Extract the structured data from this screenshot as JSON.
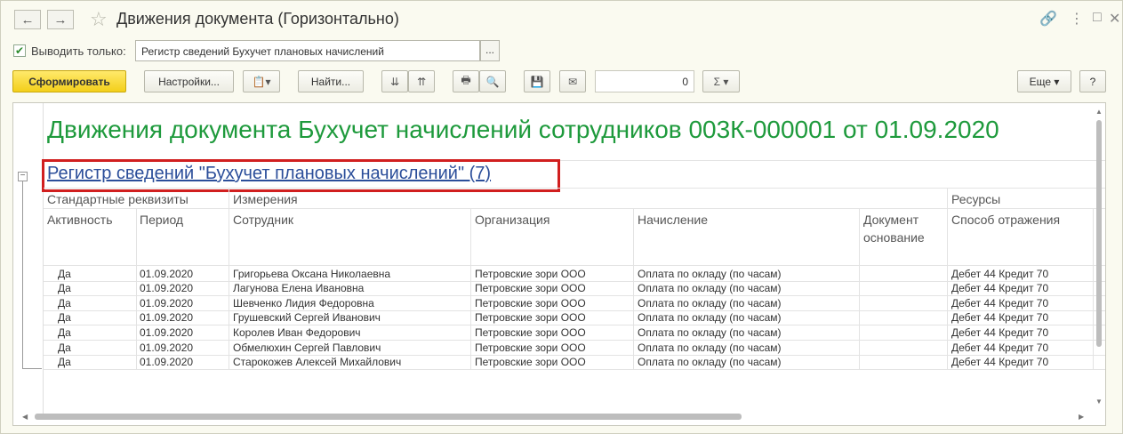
{
  "window": {
    "title": "Движения документа (Горизонтально)",
    "nav_back": "←",
    "nav_forward": "→",
    "favorite_icon": "☆",
    "link_icon": "🔗",
    "menu_icon": "⋮",
    "maximize_icon": "□",
    "close_icon": "✕"
  },
  "filter": {
    "checked": "✔",
    "label": "Выводить только:",
    "value": "Регистр сведений Бухучет плановых начислений",
    "select_button": "..."
  },
  "toolbar": {
    "generate_label": "Сформировать",
    "settings_label": "Настройки...",
    "variants_icon": "📋▾",
    "find_label": "Найти...",
    "expand_icon": "⇊",
    "collapse_icon": "⇈",
    "print_icon": "🖶",
    "preview_icon": "🔍",
    "save_icon": "💾",
    "mail_icon": "✉",
    "counter_value": "0",
    "sum_label": "Σ ▾",
    "more_label": "Еще ▾",
    "help_label": "?"
  },
  "report": {
    "title": "Движения документа Бухучет начислений сотрудников 003К-000001 от 01.09.2020",
    "register_link": "Регистр сведений \"Бухучет плановых начислений\" (7)",
    "group_toggle": "−",
    "header_groups": {
      "standard": "Стандартные реквизиты",
      "dimensions": "Измерения",
      "resources": "Ресурсы"
    },
    "columns": {
      "active": "Активность",
      "period": "Период",
      "employee": "Сотрудник",
      "organization": "Организация",
      "accrual": "Начисление",
      "document_line1": "Документ",
      "document_line2": "основание",
      "method": "Способ отражения"
    },
    "rows": [
      {
        "active": "Да",
        "period": "01.09.2020",
        "employee": "Григорьева Оксана Николаевна",
        "organization": "Петровские зори ООО",
        "accrual": "Оплата по окладу (по часам)",
        "method": "Дебет 44 Кредит 70"
      },
      {
        "active": "Да",
        "period": "01.09.2020",
        "employee": "Лагунова Елена Ивановна",
        "organization": "Петровские зори ООО",
        "accrual": "Оплата по окладу (по часам)",
        "method": "Дебет 44 Кредит 70"
      },
      {
        "active": "Да",
        "period": "01.09.2020",
        "employee": "Шевченко Лидия Федоровна",
        "organization": "Петровские зори ООО",
        "accrual": "Оплата по окладу (по часам)",
        "method": "Дебет 44 Кредит 70"
      },
      {
        "active": "Да",
        "period": "01.09.2020",
        "employee": "Грушевский Сергей Иванович",
        "organization": "Петровские зори ООО",
        "accrual": "Оплата по окладу (по часам)",
        "method": "Дебет 44 Кредит 70"
      },
      {
        "active": "Да",
        "period": "01.09.2020",
        "employee": "Королев Иван Федорович",
        "organization": "Петровские зори ООО",
        "accrual": "Оплата по окладу (по часам)",
        "method": "Дебет 44 Кредит 70"
      },
      {
        "active": "Да",
        "period": "01.09.2020",
        "employee": "Обмелюхин Сергей Павлович",
        "organization": "Петровские зори ООО",
        "accrual": "Оплата по окладу (по часам)",
        "method": "Дебет 44 Кредит 70"
      },
      {
        "active": "Да",
        "period": "01.09.2020",
        "employee": "Старокожев Алексей Михайлович",
        "organization": "Петровские зори ООО",
        "accrual": "Оплата по окладу (по часам)",
        "method": "Дебет 44 Кредит 70"
      }
    ]
  },
  "scroll": {
    "up_arrow": "▲",
    "down_arrow": "▼",
    "left_arrow": "◀",
    "right_arrow": "▶"
  },
  "colors": {
    "title_green": "#1e9a3c",
    "link_blue": "#2b4e9a",
    "highlight_red": "#d11f1f",
    "primary_yellow": "#f3cf1a"
  }
}
